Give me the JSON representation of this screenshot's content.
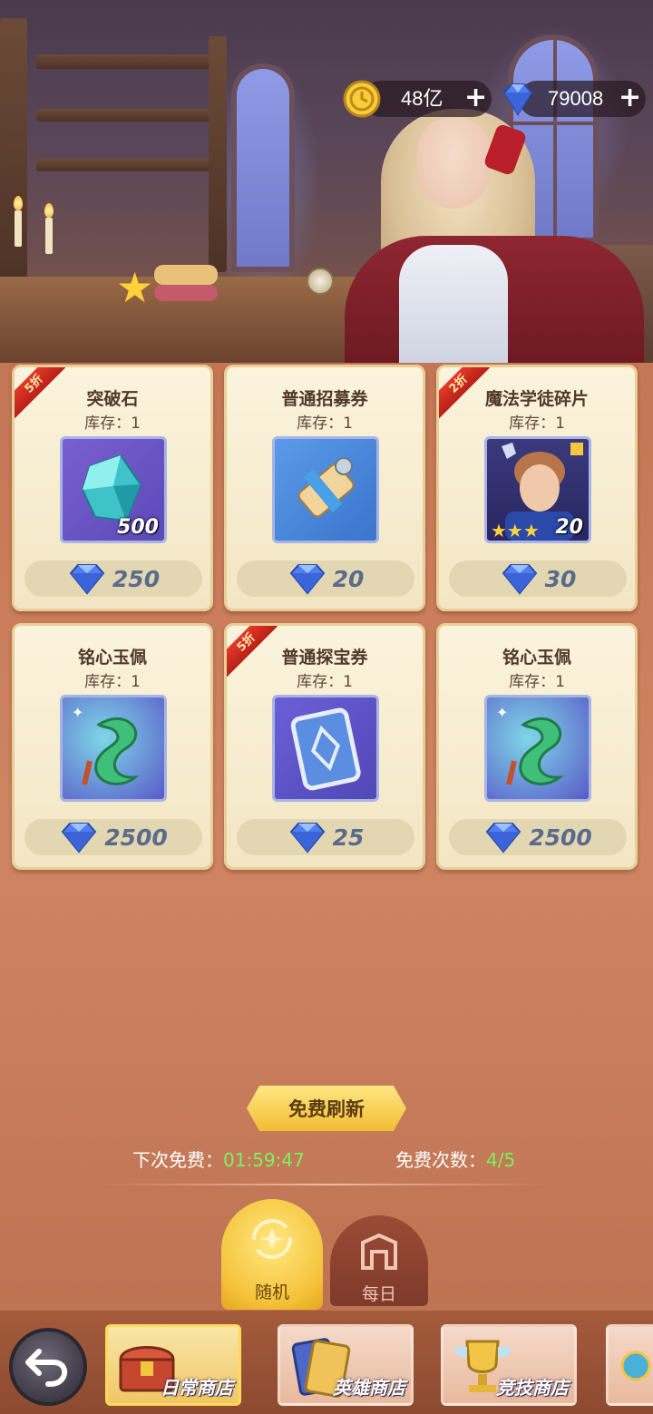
{
  "currency": {
    "gold": {
      "value": "48亿",
      "icon": "gold-coin-icon",
      "plus": "+"
    },
    "diamond": {
      "value": "79008",
      "icon": "diamond-icon",
      "plus": "+"
    }
  },
  "stock_label_prefix": "库存：",
  "items": [
    {
      "name": "突破石",
      "stock": "库存：1",
      "qty": "500",
      "price": "250",
      "badge": "5折",
      "icon": "crystal-stone-icon"
    },
    {
      "name": "普通招募券",
      "stock": "库存：1",
      "qty": "",
      "price": "20",
      "badge": "",
      "icon": "scroll-ticket-icon"
    },
    {
      "name": "魔法学徒碎片",
      "stock": "库存：1",
      "qty": "20",
      "price": "30",
      "badge": "2折",
      "icon": "hero-shard-icon"
    },
    {
      "name": "铭心玉佩",
      "stock": "库存：1",
      "qty": "",
      "price": "2500",
      "badge": "",
      "icon": "jade-pendant-icon"
    },
    {
      "name": "普通探宝券",
      "stock": "库存：1",
      "qty": "",
      "price": "25",
      "badge": "5折",
      "icon": "treasure-card-icon"
    },
    {
      "name": "铭心玉佩",
      "stock": "库存：1",
      "qty": "",
      "price": "2500",
      "badge": "",
      "icon": "jade-pendant-icon"
    }
  ],
  "refresh": {
    "button_label": "免费刷新",
    "next_free_label": "下次免费：",
    "next_free_time": "01:59:47",
    "free_count_label": "免费次数：",
    "free_count": "4/5"
  },
  "sub_tabs": [
    {
      "label": "随机",
      "active": true
    },
    {
      "label": "每日",
      "active": false
    }
  ],
  "nav": [
    {
      "label": "日常商店",
      "active": true
    },
    {
      "label": "英雄商店",
      "active": false
    },
    {
      "label": "竞技商店",
      "active": false
    }
  ],
  "colors": {
    "accent_gold": "#f5c33a",
    "timer_green": "#7cf35f",
    "badge_red": "#d42d20",
    "price_blue": "#5b6b8c"
  }
}
